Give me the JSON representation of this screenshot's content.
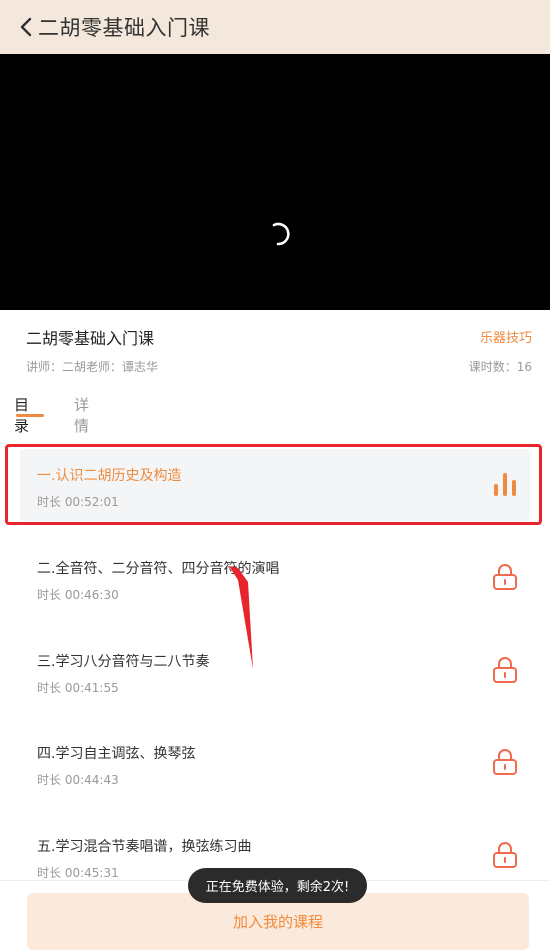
{
  "header": {
    "title": "二胡零基础入门课"
  },
  "course": {
    "title": "二胡零基础入门课",
    "category": "乐器技巧",
    "teacher": "讲师：二胡老师：谭志华",
    "lesson_count": "课时数：16"
  },
  "tabs": [
    {
      "label": "目录",
      "active": true
    },
    {
      "label": "详情",
      "active": false
    }
  ],
  "lessons": [
    {
      "name": "一.认识二胡历史及构造",
      "duration": "时长 00:52:01",
      "icon": "playing-bars-icon",
      "state": "playing"
    },
    {
      "name": "二.全音符、二分音符、四分音符的演唱",
      "duration": "时长 00:46:30",
      "icon": "lock-icon",
      "state": "locked"
    },
    {
      "name": "三.学习八分音符与二八节奏",
      "duration": "时长 00:41:55",
      "icon": "lock-icon",
      "state": "locked"
    },
    {
      "name": "四.学习自主调弦、换琴弦",
      "duration": "时长 00:44:43",
      "icon": "lock-icon",
      "state": "locked"
    },
    {
      "name": "五.学习混合节奏唱谱，换弦练习曲",
      "duration": "时长 00:45:31",
      "icon": "lock-icon",
      "state": "locked"
    }
  ],
  "toast": "正在免费体验，剩余2次!",
  "join_button": "加入我的课程",
  "colors": {
    "accent": "#f08a3c",
    "header_bg": "#f4e8dc",
    "annotation": "#e8242c"
  }
}
